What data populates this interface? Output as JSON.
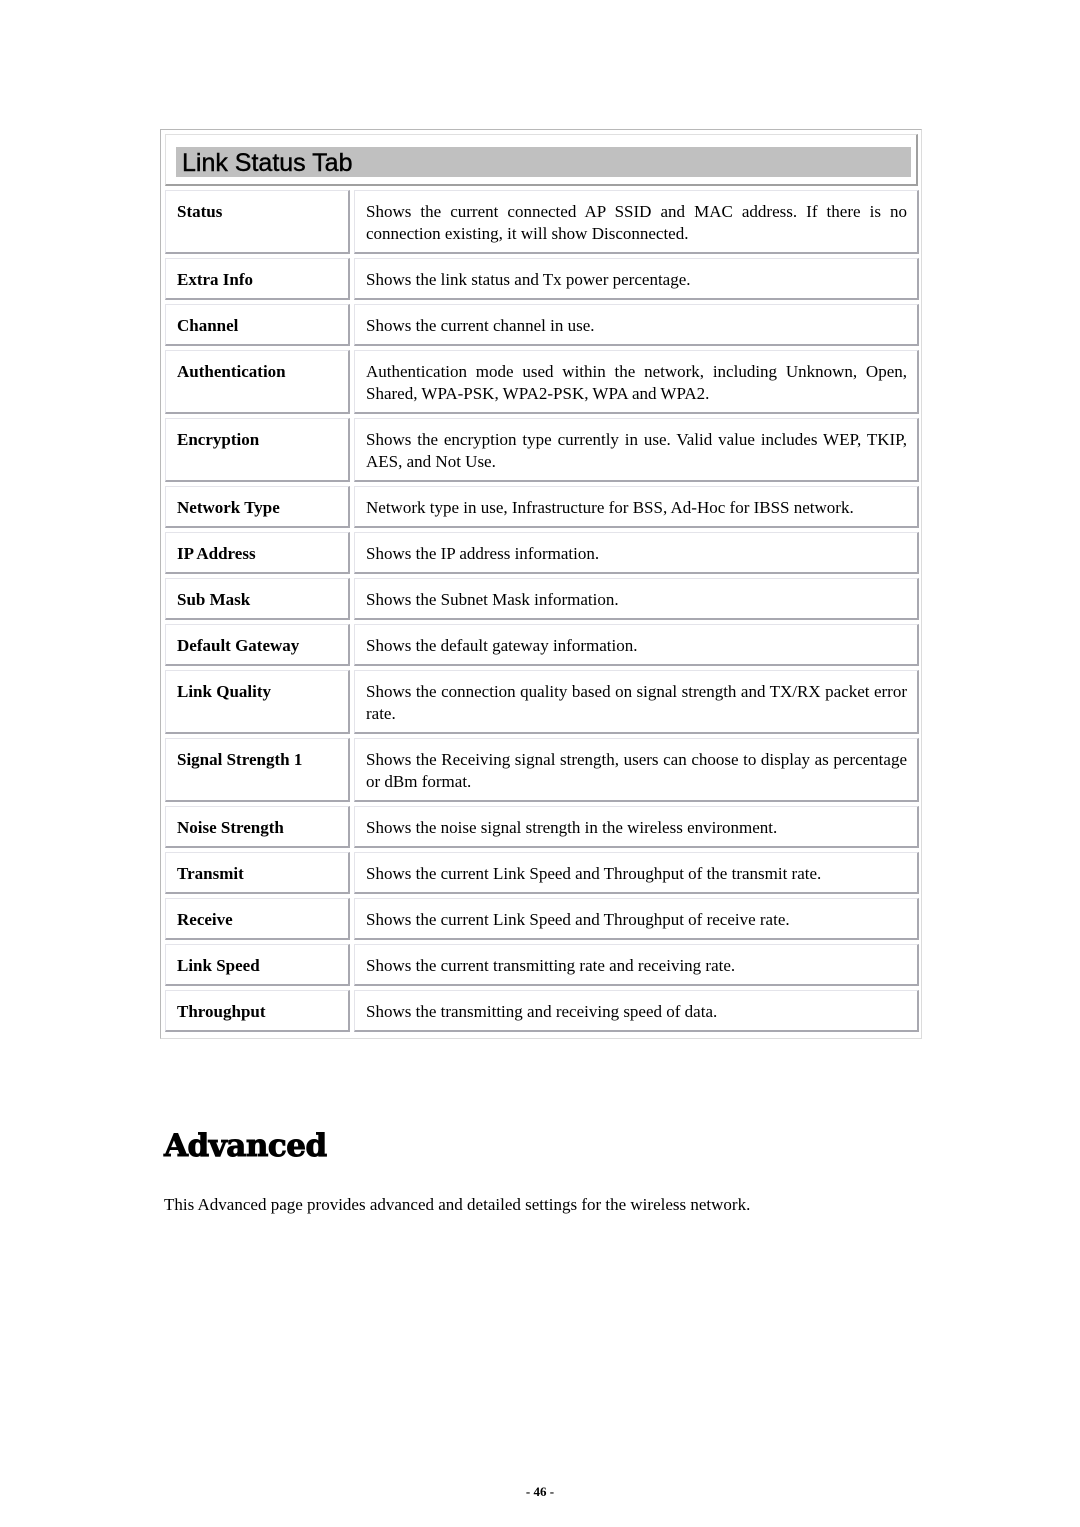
{
  "link_status_table": {
    "title": "Link Status Tab",
    "rows": [
      {
        "label": "Status",
        "description": "Shows the current connected AP SSID and MAC address. If there is no connection existing, it will show Disconnected."
      },
      {
        "label": "Extra Info",
        "description": "Shows the link status and Tx power percentage."
      },
      {
        "label": "Channel",
        "description": "Shows the current channel in use."
      },
      {
        "label": "Authentication",
        "description": "Authentication mode used within the network, including Unknown, Open, Shared, WPA-PSK, WPA2-PSK, WPA and WPA2."
      },
      {
        "label": "Encryption",
        "description": "Shows the encryption type currently in use. Valid value includes WEP, TKIP, AES, and Not Use."
      },
      {
        "label": "Network Type",
        "description": "Network type in use, Infrastructure for BSS, Ad-Hoc for IBSS network."
      },
      {
        "label": "IP Address",
        "description": "Shows the IP address information."
      },
      {
        "label": "Sub Mask",
        "description": "Shows the Subnet Mask information."
      },
      {
        "label": "Default Gateway",
        "description": "Shows the default gateway information."
      },
      {
        "label": "Link Quality",
        "description": "Shows the connection quality based on signal strength and TX/RX packet error rate."
      },
      {
        "label": "Signal Strength 1",
        "description": "Shows the Receiving signal strength, users can choose to display as percentage or dBm format."
      },
      {
        "label": "Noise Strength",
        "description": "Shows the noise signal strength in the wireless environment."
      },
      {
        "label": "Transmit",
        "description": "Shows the current Link Speed and Throughput of the transmit rate."
      },
      {
        "label": "Receive",
        "description": "Shows the current Link Speed and Throughput of receive rate."
      },
      {
        "label": "Link Speed",
        "description": "Shows the current transmitting rate and receiving rate."
      },
      {
        "label": "Throughput",
        "description": "Shows the transmitting and receiving speed of data."
      }
    ]
  },
  "advanced_section": {
    "heading": "Advanced",
    "body": "This Advanced page provides advanced and detailed settings for the wireless network."
  },
  "footer": {
    "page_number": "- 46 -"
  }
}
